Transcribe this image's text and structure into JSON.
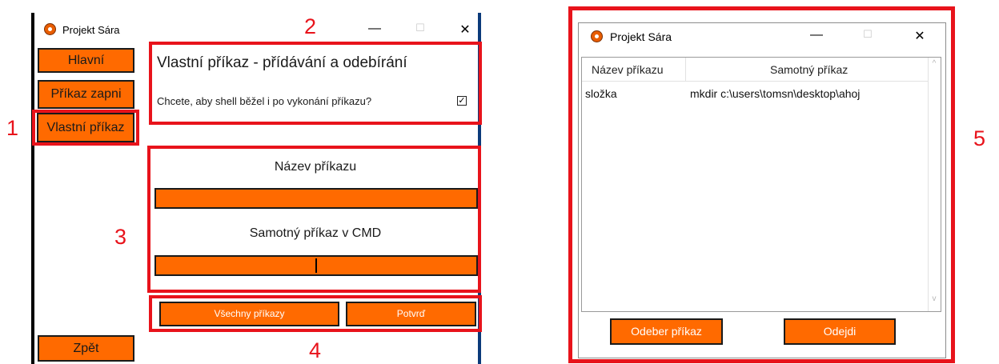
{
  "left_window": {
    "title": "Projekt Sára",
    "controls": {
      "minimize": "—",
      "maximize": "☐",
      "close": "✕"
    },
    "nav": {
      "main": "Hlavní",
      "command_on": "Příkaz zapni",
      "custom_command": "Vlastní příkaz",
      "back": "Zpět"
    },
    "heading": "Vlastní příkaz - přídávání a odebírání",
    "question": "Chcete, aby shell běžel i po vykonání příkazu?",
    "checkbox_mark": "☑",
    "command_name_label": "Název příkazu",
    "cmd_label": "Samotný příkaz v CMD",
    "all_commands_button": "Všechny příkazy",
    "confirm_button": "Potvrď"
  },
  "annotations": [
    "1",
    "2",
    "3",
    "4",
    "5"
  ],
  "right_window": {
    "title": "Projekt Sára",
    "controls": {
      "minimize": "—",
      "maximize": "☐",
      "close": "✕"
    },
    "columns": [
      "Název příkazu",
      "Samotný příkaz"
    ],
    "rows": [
      {
        "name": "složka",
        "command": "mkdir c:\\users\\tomsn\\desktop\\ahoj"
      }
    ],
    "scroll_up": "^",
    "scroll_down": "v",
    "remove_button": "Odeber příkaz",
    "exit_button": "Odejdi"
  },
  "colors": {
    "accent": "#ff6a00",
    "annotation": "#e8131b"
  }
}
